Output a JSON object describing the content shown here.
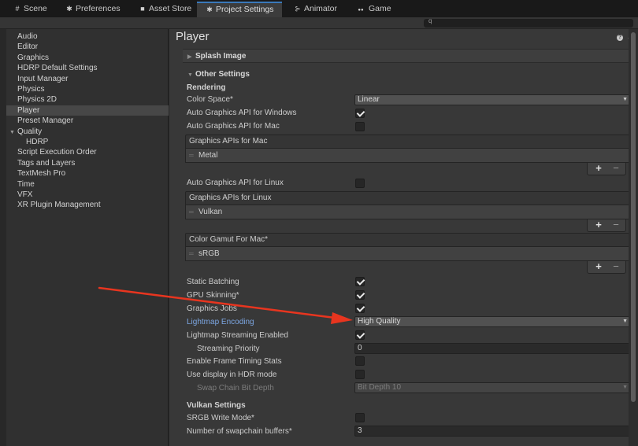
{
  "tabs": [
    {
      "label": "Scene",
      "icon": "#"
    },
    {
      "label": "Preferences",
      "icon": "✱"
    },
    {
      "label": "Asset Store",
      "icon": "■"
    },
    {
      "label": "Project Settings",
      "icon": "✱"
    },
    {
      "label": "Animator",
      "icon": "⊱"
    },
    {
      "label": "Game",
      "icon": "●●"
    }
  ],
  "search": {
    "icon": "q"
  },
  "sidebar": {
    "items": [
      {
        "label": "Audio"
      },
      {
        "label": "Editor"
      },
      {
        "label": "Graphics"
      },
      {
        "label": "HDRP Default Settings"
      },
      {
        "label": "Input Manager"
      },
      {
        "label": "Physics"
      },
      {
        "label": "Physics 2D"
      },
      {
        "label": "Player"
      },
      {
        "label": "Preset Manager"
      },
      {
        "label": "Quality"
      },
      {
        "label": "HDRP"
      },
      {
        "label": "Script Execution Order"
      },
      {
        "label": "Tags and Layers"
      },
      {
        "label": "TextMesh Pro"
      },
      {
        "label": "Time"
      },
      {
        "label": "VFX"
      },
      {
        "label": "XR Plugin Management"
      }
    ],
    "selected": "Player"
  },
  "header": {
    "title": "Player",
    "help": "?",
    "settings": "⇵"
  },
  "sections": {
    "splash": "Splash Image",
    "other": "Other Settings",
    "rendering": "Rendering",
    "vulkan": "Vulkan Settings"
  },
  "fields": {
    "color_space": {
      "label": "Color Space*",
      "value": "Linear"
    },
    "auto_gfx_windows": {
      "label": "Auto Graphics API  for Windows",
      "checked": true
    },
    "auto_gfx_mac": {
      "label": "Auto Graphics API  for Mac",
      "checked": false
    },
    "gfx_apis_mac": {
      "header": "Graphics APIs for Mac",
      "item": "Metal"
    },
    "auto_gfx_linux": {
      "label": "Auto Graphics API  for Linux",
      "checked": false
    },
    "gfx_apis_linux": {
      "header": "Graphics APIs for Linux",
      "item": "Vulkan"
    },
    "color_gamut_mac": {
      "header": "Color Gamut For Mac*",
      "item": "sRGB"
    },
    "static_batching": {
      "label": "Static Batching",
      "checked": true
    },
    "gpu_skinning": {
      "label": "GPU Skinning*",
      "checked": true
    },
    "graphics_jobs": {
      "label": "Graphics Jobs",
      "checked": true
    },
    "lightmap_encoding": {
      "label": "Lightmap Encoding",
      "value": "High Quality"
    },
    "lightmap_streaming": {
      "label": "Lightmap Streaming Enabled",
      "checked": true
    },
    "streaming_priority": {
      "label": "Streaming Priority",
      "value": "0"
    },
    "frame_timing": {
      "label": "Enable Frame Timing Stats",
      "checked": false
    },
    "hdr_display": {
      "label": "Use display in HDR mode",
      "checked": false
    },
    "swap_chain_depth": {
      "label": "Swap Chain Bit Depth",
      "value": "Bit Depth 10"
    },
    "srgb_write": {
      "label": "SRGB Write Mode*",
      "checked": false
    },
    "swapchain_buffers": {
      "label": "Number of swapchain buffers*",
      "value": "3"
    }
  },
  "list_buttons": {
    "add": "+",
    "remove": "−"
  },
  "colors": {
    "accent": "#3a79bb",
    "annotation_arrow": "#e8351f",
    "highlight_label": "#7ca6e2"
  }
}
